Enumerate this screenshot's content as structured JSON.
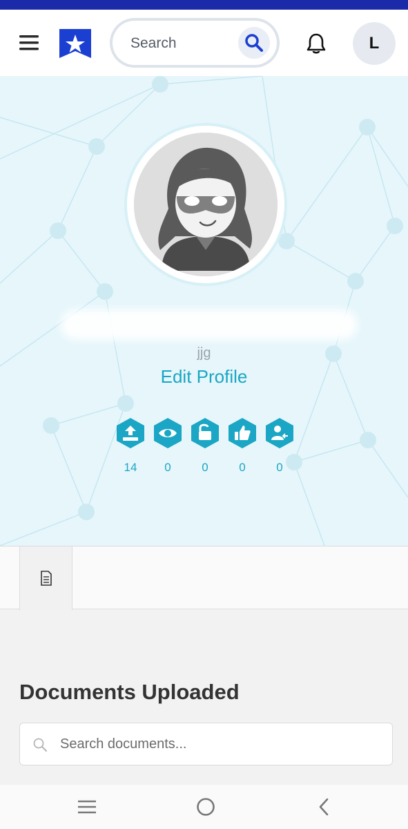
{
  "header": {
    "search_placeholder": "Search",
    "avatar_initial": "L",
    "icons": [
      "menu-icon",
      "star-shield-logo",
      "search-icon",
      "bell-icon"
    ]
  },
  "profile": {
    "username": "jjg",
    "edit_label": "Edit Profile",
    "stats": [
      {
        "icon": "upload-icon",
        "value": "14"
      },
      {
        "icon": "eye-icon",
        "value": "0"
      },
      {
        "icon": "unlock-icon",
        "value": "0"
      },
      {
        "icon": "thumbs-up-icon",
        "value": "0"
      },
      {
        "icon": "user-icon",
        "value": "0"
      }
    ]
  },
  "tabs": [
    {
      "icon": "document-icon"
    }
  ],
  "documents": {
    "title": "Documents Uploaded",
    "search_placeholder": "Search documents..."
  },
  "colors": {
    "accent": "#1aa6c4",
    "brand": "#1b3fd1",
    "hero_bg": "#e6f6fb"
  }
}
